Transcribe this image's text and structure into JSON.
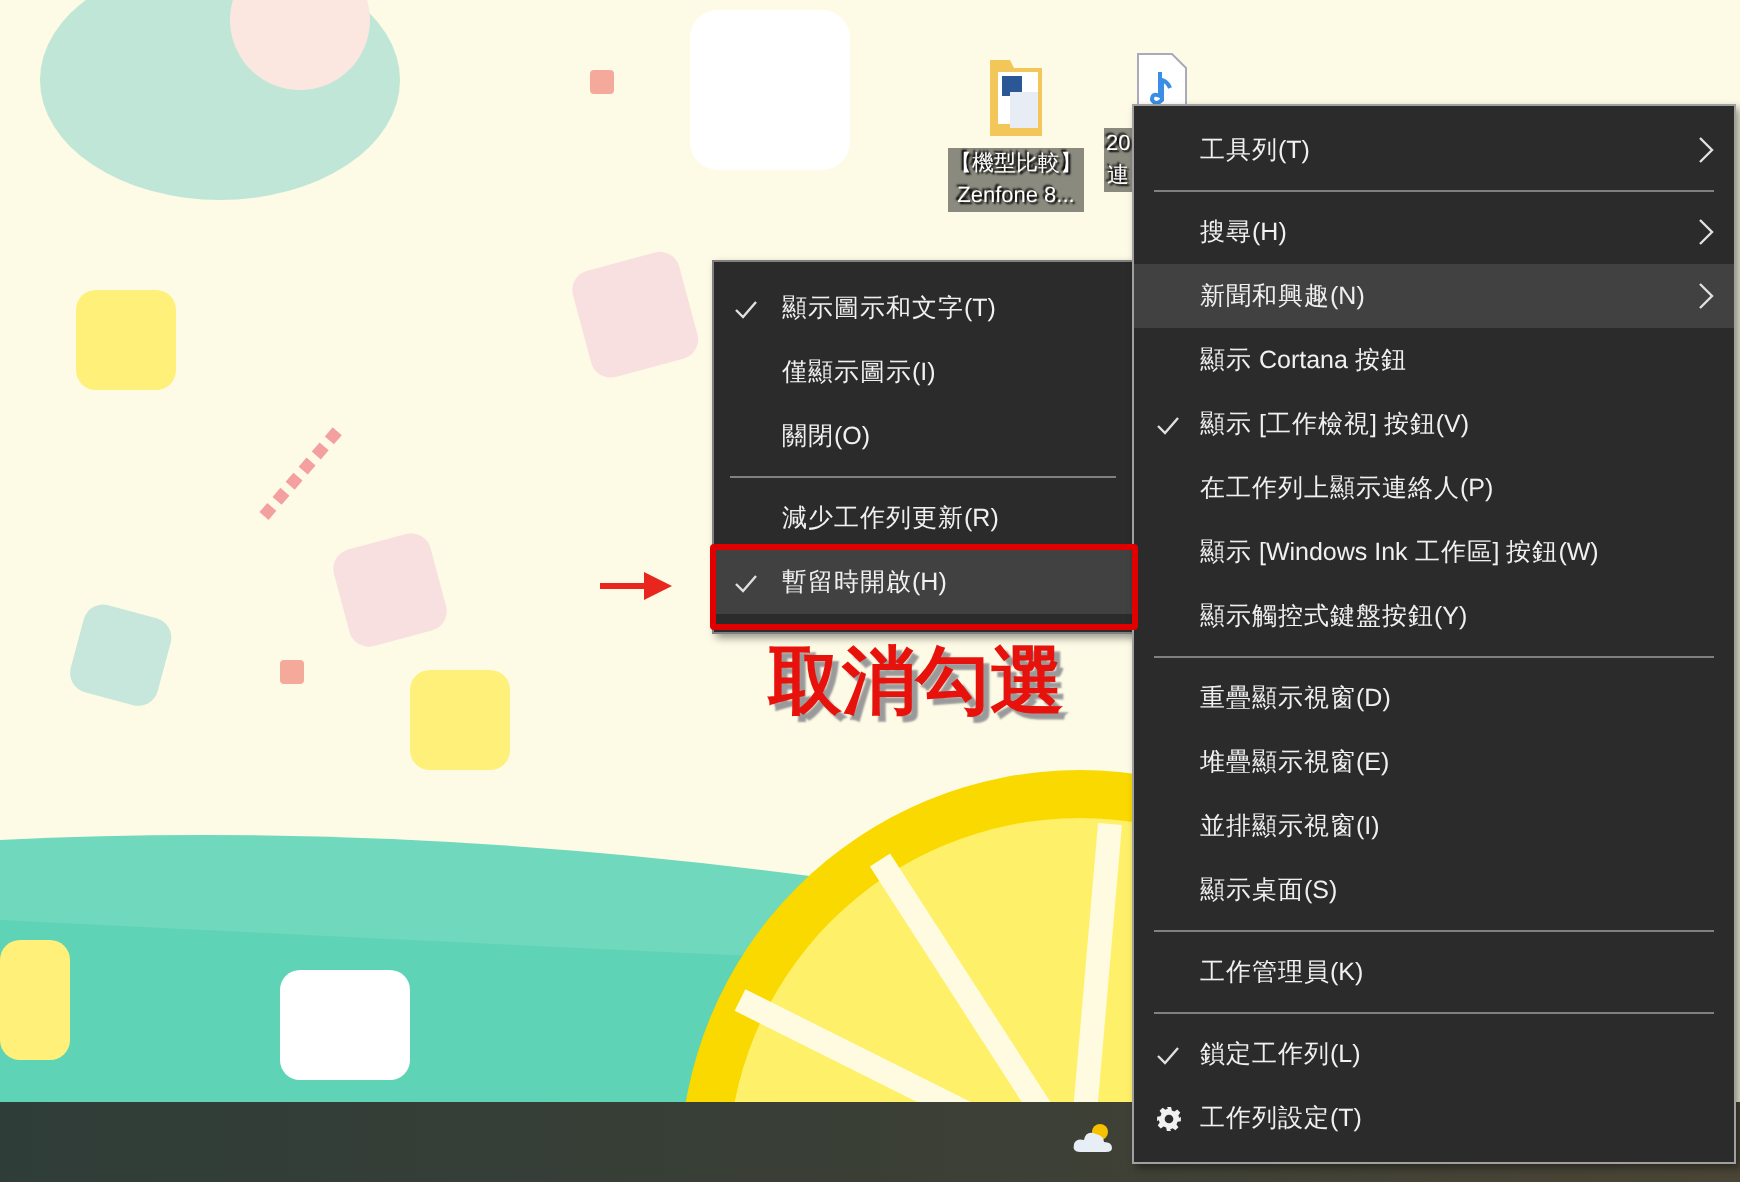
{
  "desktop_icons": [
    {
      "kind": "folder",
      "label_lines": [
        "【機型比較】",
        "Zenfone 8..."
      ]
    },
    {
      "kind": "document",
      "label_lines": [
        "20",
        "連"
      ]
    }
  ],
  "news_submenu": {
    "items": [
      {
        "kind": "item",
        "label": "顯示圖示和文字(T)",
        "checked": true,
        "selected": false
      },
      {
        "kind": "item",
        "label": "僅顯示圖示(I)",
        "checked": false,
        "selected": false
      },
      {
        "kind": "item",
        "label": "關閉(O)",
        "checked": false,
        "selected": false
      },
      {
        "kind": "separator"
      },
      {
        "kind": "item",
        "label": "減少工作列更新(R)",
        "checked": false,
        "selected": false
      },
      {
        "kind": "item",
        "label": "暫留時開啟(H)",
        "checked": true,
        "selected": true
      }
    ]
  },
  "taskbar_menu": {
    "items": [
      {
        "kind": "item",
        "label": "工具列(T)",
        "checked": false,
        "has_submenu": true,
        "selected": false
      },
      {
        "kind": "separator"
      },
      {
        "kind": "item",
        "label": "搜尋(H)",
        "checked": false,
        "has_submenu": true,
        "selected": false
      },
      {
        "kind": "item",
        "label": "新聞和興趣(N)",
        "checked": false,
        "has_submenu": true,
        "selected": true
      },
      {
        "kind": "item",
        "label": "顯示 Cortana 按鈕",
        "checked": false,
        "has_submenu": false,
        "selected": false
      },
      {
        "kind": "item",
        "label": "顯示 [工作檢視] 按鈕(V)",
        "checked": true,
        "has_submenu": false,
        "selected": false
      },
      {
        "kind": "item",
        "label": "在工作列上顯示連絡人(P)",
        "checked": false,
        "has_submenu": false,
        "selected": false
      },
      {
        "kind": "item",
        "label": "顯示 [Windows Ink 工作區] 按鈕(W)",
        "checked": false,
        "has_submenu": false,
        "selected": false
      },
      {
        "kind": "item",
        "label": "顯示觸控式鍵盤按鈕(Y)",
        "checked": false,
        "has_submenu": false,
        "selected": false
      },
      {
        "kind": "separator"
      },
      {
        "kind": "item",
        "label": "重疊顯示視窗(D)",
        "checked": false,
        "has_submenu": false,
        "selected": false
      },
      {
        "kind": "item",
        "label": "堆疊顯示視窗(E)",
        "checked": false,
        "has_submenu": false,
        "selected": false
      },
      {
        "kind": "item",
        "label": "並排顯示視窗(I)",
        "checked": false,
        "has_submenu": false,
        "selected": false
      },
      {
        "kind": "item",
        "label": "顯示桌面(S)",
        "checked": false,
        "has_submenu": false,
        "selected": false
      },
      {
        "kind": "separator"
      },
      {
        "kind": "item",
        "label": "工作管理員(K)",
        "checked": false,
        "has_submenu": false,
        "selected": false
      },
      {
        "kind": "separator"
      },
      {
        "kind": "item",
        "label": "鎖定工作列(L)",
        "checked": true,
        "has_submenu": false,
        "selected": false
      },
      {
        "kind": "gear_item",
        "label": "工作列設定(T)",
        "checked": false,
        "has_submenu": false,
        "selected": false
      }
    ]
  },
  "annotation": {
    "text": "取消勾選"
  }
}
